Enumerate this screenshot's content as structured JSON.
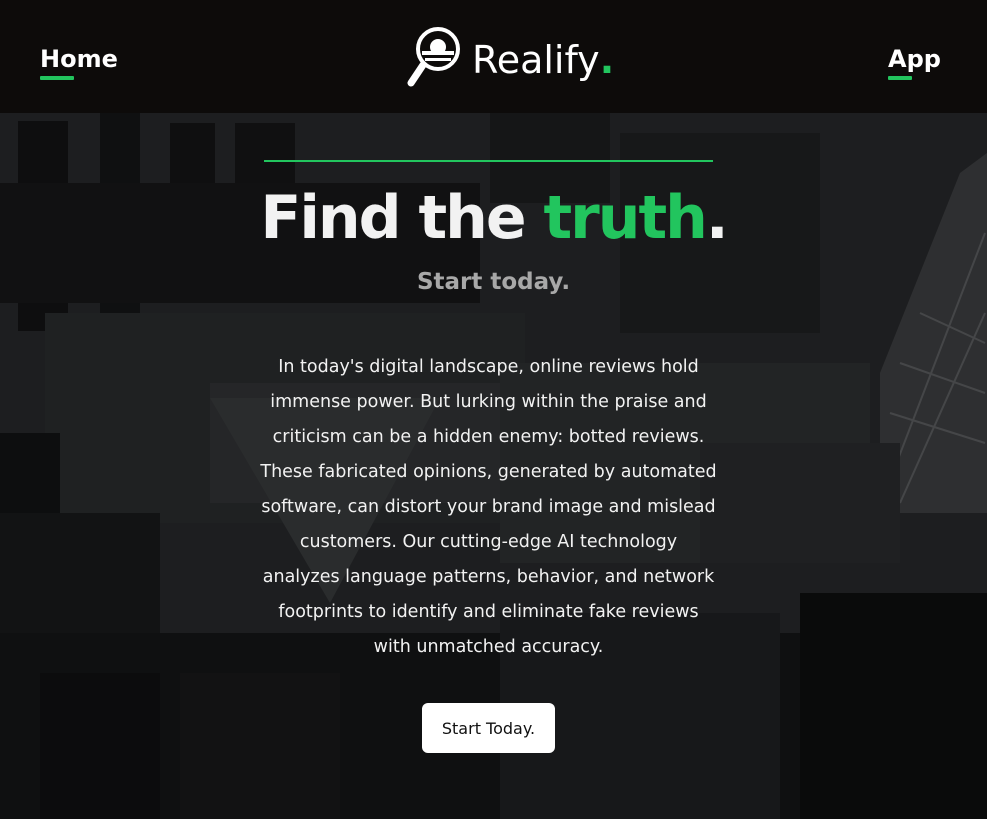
{
  "nav": {
    "home_label": "Home",
    "app_label": "App",
    "brand_name": "Realify",
    "brand_dot": ".",
    "logo_icon": "magnifier-logo-icon"
  },
  "hero": {
    "headline_part1": "Find the ",
    "headline_accent": "truth",
    "headline_end": ".",
    "subheading": "Start today.",
    "description": "In today's digital landscape, online reviews hold immense power. But lurking within the praise and criticism can be a hidden enemy: botted reviews. These fabricated opinions, generated by automated software, can distort your brand image and mislead customers. Our cutting-edge AI technology analyzes language patterns, behavior, and network footprints to identify and eliminate fake reviews with unmatched accuracy.",
    "cta_label": "Start Today."
  },
  "colors": {
    "accent": "#22c55e",
    "navbar_bg": "#0d0b0a",
    "text_light": "#f2f2f2",
    "text_muted": "#a8a8a8",
    "button_bg": "#ffffff"
  }
}
